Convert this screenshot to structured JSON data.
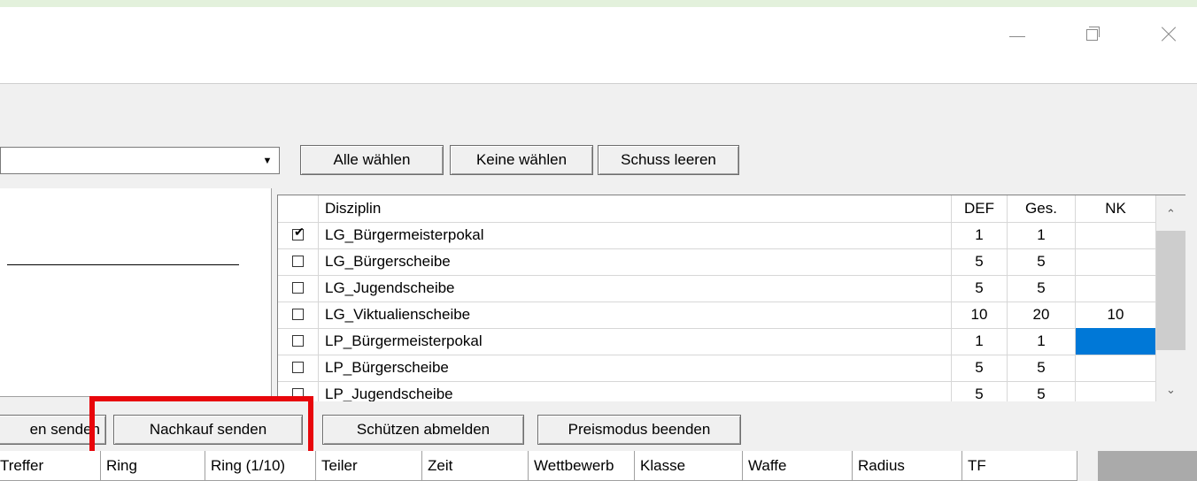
{
  "window": {
    "controls": {
      "minimize": "minimize-icon",
      "maximize": "maximize-icon",
      "close": "close-icon"
    }
  },
  "combo": {
    "value": "",
    "arrow": "▼"
  },
  "top_buttons": {
    "select_all": "Alle wählen",
    "select_none": "Keine wählen",
    "clear_shot": "Schuss leeren"
  },
  "grid": {
    "headers": {
      "check": "",
      "discipline": "Disziplin",
      "def": "DEF",
      "ges": "Ges.",
      "nk": "NK"
    },
    "rows": [
      {
        "checked": true,
        "discipline": "LG_Bürgermeisterpokal",
        "def": "1",
        "ges": "1",
        "nk": ""
      },
      {
        "checked": false,
        "discipline": "LG_Bürgerscheibe",
        "def": "5",
        "ges": "5",
        "nk": ""
      },
      {
        "checked": false,
        "discipline": "LG_Jugendscheibe",
        "def": "5",
        "ges": "5",
        "nk": ""
      },
      {
        "checked": false,
        "discipline": "LG_Viktualienscheibe",
        "def": "10",
        "ges": "20",
        "nk": "10"
      },
      {
        "checked": false,
        "discipline": "LP_Bürgermeisterpokal",
        "def": "1",
        "ges": "1",
        "nk": ""
      },
      {
        "checked": false,
        "discipline": "LP_Bürgerscheibe",
        "def": "5",
        "ges": "5",
        "nk": ""
      },
      {
        "checked": false,
        "discipline": "LP_Jugendscheibe",
        "def": "5",
        "ges": "5",
        "nk": ""
      }
    ],
    "scroll_up": "⌃",
    "scroll_down": "⌄",
    "check_mark": "✔"
  },
  "action_buttons": {
    "send_partial": "en senden",
    "send_repurchase": "Nachkauf senden",
    "logout_shooter": "Schützen abmelden",
    "end_price_mode": "Preismodus beenden"
  },
  "result_columns": [
    "Treffer",
    "Ring",
    "Ring (1/10)",
    "Teiler",
    "Zeit",
    "Wettbewerb",
    "Klasse",
    "Waffe",
    "Radius",
    "TF"
  ],
  "colors": {
    "highlight": "#e8060b",
    "selection": "#0078d7",
    "background": "#e3f1dc"
  }
}
